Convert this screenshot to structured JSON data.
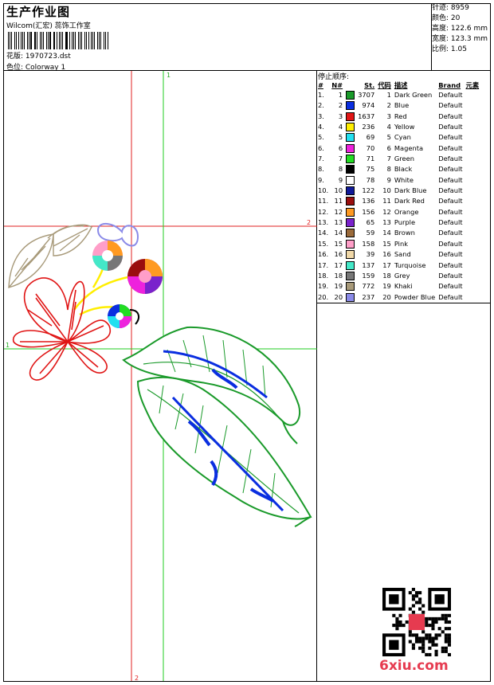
{
  "header": {
    "title": "生产作业图",
    "company": "Wilcom(汇宏) 蕊饰工作室",
    "design": "花版: 1970723.dst",
    "colorway": "色位: Colorway 1"
  },
  "stats": {
    "stitches": "针迹: 8959",
    "colors": "颜色: 20",
    "height": "高度: 122.6 mm",
    "width": "宽度: 123.3 mm",
    "ratio": "比例: 1.05"
  },
  "stop_sequence": {
    "title": "停止顺序:",
    "headers": [
      "#",
      "N#",
      "St.",
      "代码",
      "描述",
      "Brand",
      "元素"
    ],
    "rows": [
      {
        "idx": "1.",
        "n": "1",
        "color": "#1a9a2a",
        "st": "3707",
        "code": "1",
        "desc": "Dark Green",
        "brand": "Default"
      },
      {
        "idx": "2.",
        "n": "2",
        "color": "#0a2ee0",
        "st": "974",
        "code": "2",
        "desc": "Blue",
        "brand": "Default"
      },
      {
        "idx": "3.",
        "n": "3",
        "color": "#e01515",
        "st": "1637",
        "code": "3",
        "desc": "Red",
        "brand": "Default"
      },
      {
        "idx": "4.",
        "n": "4",
        "color": "#ffee00",
        "st": "236",
        "code": "4",
        "desc": "Yellow",
        "brand": "Default"
      },
      {
        "idx": "5.",
        "n": "5",
        "color": "#22e0f0",
        "st": "69",
        "code": "5",
        "desc": "Cyan",
        "brand": "Default"
      },
      {
        "idx": "6.",
        "n": "6",
        "color": "#ee22dd",
        "st": "70",
        "code": "6",
        "desc": "Magenta",
        "brand": "Default"
      },
      {
        "idx": "7.",
        "n": "7",
        "color": "#22dd22",
        "st": "71",
        "code": "7",
        "desc": "Green",
        "brand": "Default"
      },
      {
        "idx": "8.",
        "n": "8",
        "color": "#000000",
        "st": "75",
        "code": "8",
        "desc": "Black",
        "brand": "Default"
      },
      {
        "idx": "9.",
        "n": "9",
        "color": "#ffffff",
        "st": "78",
        "code": "9",
        "desc": "White",
        "brand": "Default"
      },
      {
        "idx": "10.",
        "n": "10",
        "color": "#101a9a",
        "st": "122",
        "code": "10",
        "desc": "Dark Blue",
        "brand": "Default"
      },
      {
        "idx": "11.",
        "n": "11",
        "color": "#9a0e0e",
        "st": "136",
        "code": "11",
        "desc": "Dark Red",
        "brand": "Default"
      },
      {
        "idx": "12.",
        "n": "12",
        "color": "#ff9a22",
        "st": "156",
        "code": "12",
        "desc": "Orange",
        "brand": "Default"
      },
      {
        "idx": "13.",
        "n": "13",
        "color": "#7a22cc",
        "st": "65",
        "code": "13",
        "desc": "Purple",
        "brand": "Default"
      },
      {
        "idx": "14.",
        "n": "14",
        "color": "#9a6a3a",
        "st": "59",
        "code": "14",
        "desc": "Brown",
        "brand": "Default"
      },
      {
        "idx": "15.",
        "n": "15",
        "color": "#ff9ec8",
        "st": "158",
        "code": "15",
        "desc": "Pink",
        "brand": "Default"
      },
      {
        "idx": "16.",
        "n": "16",
        "color": "#f0d8a8",
        "st": "39",
        "code": "16",
        "desc": "Sand",
        "brand": "Default"
      },
      {
        "idx": "17.",
        "n": "17",
        "color": "#44e8c8",
        "st": "137",
        "code": "17",
        "desc": "Turquoise",
        "brand": "Default"
      },
      {
        "idx": "18.",
        "n": "18",
        "color": "#777777",
        "st": "159",
        "code": "18",
        "desc": "Grey",
        "brand": "Default"
      },
      {
        "idx": "19.",
        "n": "19",
        "color": "#a89a7a",
        "st": "772",
        "code": "19",
        "desc": "Khaki",
        "brand": "Default"
      },
      {
        "idx": "20.",
        "n": "20",
        "color": "#8a8ae8",
        "st": "237",
        "code": "20",
        "desc": "Powder Blue",
        "brand": "Default"
      }
    ]
  },
  "canvas": {
    "guide_labels": {
      "top": "1",
      "right": "2",
      "left": "1",
      "bottom": "2"
    }
  },
  "watermark": {
    "text": "6xiu.com"
  }
}
